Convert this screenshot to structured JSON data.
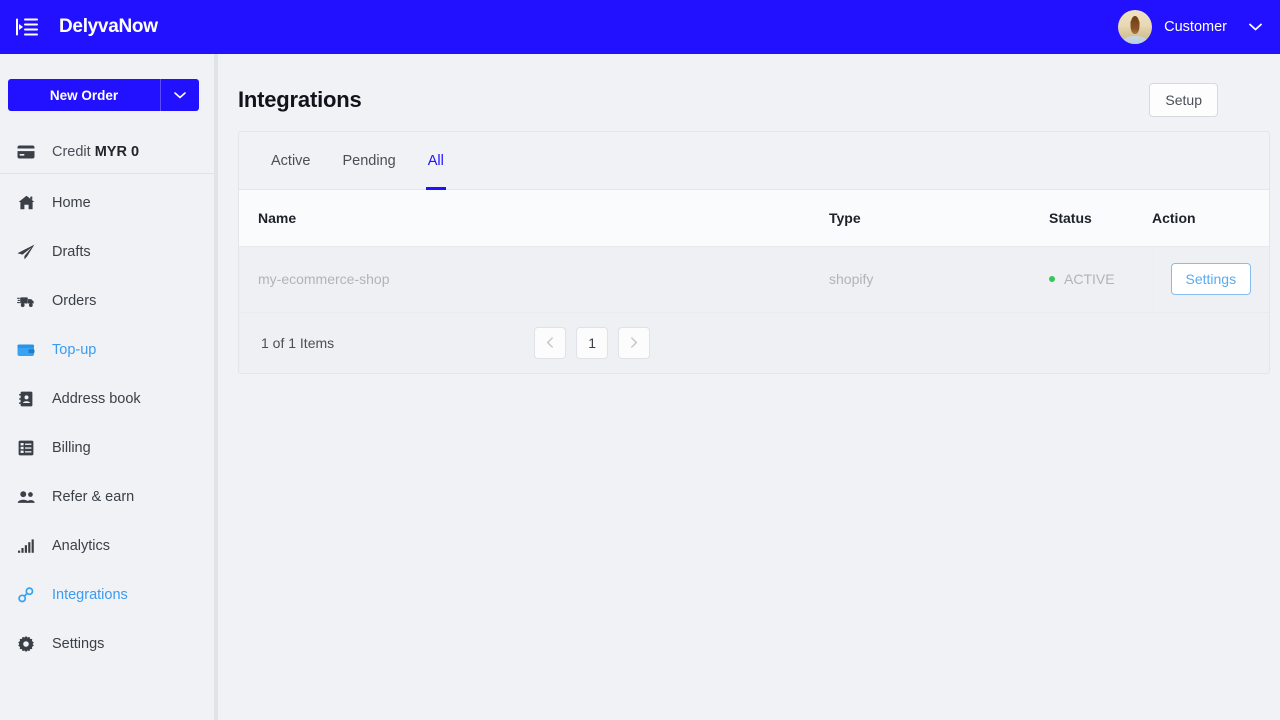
{
  "topbar": {
    "menu_icon": "menu-fold-icon",
    "brand": "DelyvaNow",
    "username": "Customer",
    "caret_icon": "chevron-down-icon",
    "bg_color": "#2211ff"
  },
  "sidebar": {
    "new_order_label": "New Order",
    "new_order_caret_icon": "chevron-down-icon",
    "credit": {
      "icon": "credit-card-icon",
      "label": "Credit",
      "amount": "MYR 0"
    },
    "items": [
      {
        "label": "Home",
        "icon": "home-icon",
        "active": false
      },
      {
        "label": "Drafts",
        "icon": "paper-plane-icon",
        "active": false
      },
      {
        "label": "Orders",
        "icon": "truck-icon",
        "active": false
      },
      {
        "label": "Top-up",
        "icon": "wallet-icon",
        "active": true
      },
      {
        "label": "Address book",
        "icon": "address-book-icon",
        "active": false
      },
      {
        "label": "Billing",
        "icon": "invoice-list-icon",
        "active": false
      },
      {
        "label": "Refer & earn",
        "icon": "people-icon",
        "active": false
      },
      {
        "label": "Analytics",
        "icon": "bar-chart-icon",
        "active": false
      },
      {
        "label": "Integrations",
        "icon": "link-chain-icon",
        "active": true
      },
      {
        "label": "Settings",
        "icon": "gear-icon",
        "active": false
      }
    ],
    "accent_color": "#3c9bf0"
  },
  "main": {
    "page_title": "Integrations",
    "setup_label": "Setup",
    "tabs": [
      {
        "label": "Active",
        "selected": false
      },
      {
        "label": "Pending",
        "selected": false
      },
      {
        "label": "All",
        "selected": true
      }
    ],
    "table": {
      "columns": [
        "Name",
        "Type",
        "Status",
        "Action"
      ],
      "rows": [
        {
          "name": "my-ecommerce-shop",
          "type": "shopify",
          "status": "ACTIVE",
          "status_color": "#34c759",
          "action_label": "Settings"
        }
      ]
    },
    "pagination": {
      "count_text": "1 of 1 Items",
      "prev_icon": "chevron-left-icon",
      "next_icon": "chevron-right-icon",
      "current_page": "1"
    }
  }
}
